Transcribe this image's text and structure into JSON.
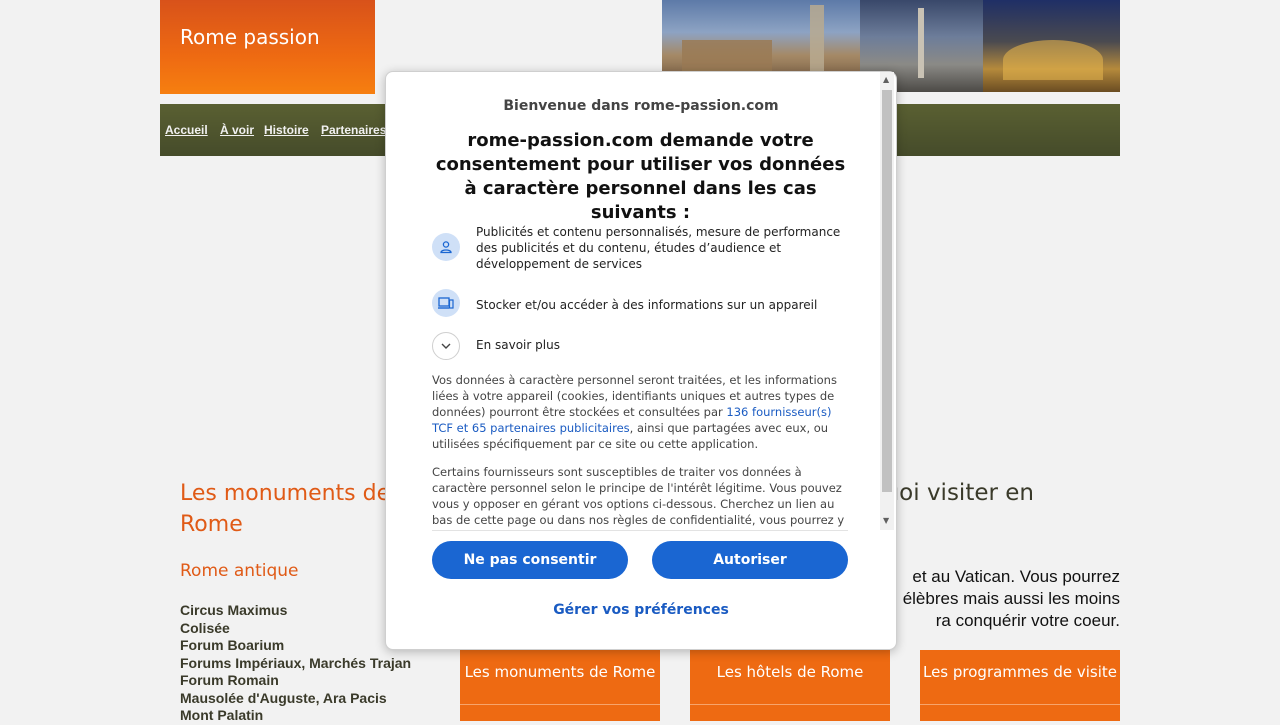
{
  "site": {
    "logo": "Rome passion",
    "nav": [
      "Accueil",
      "À voir",
      "Histoire",
      "Partenaires"
    ],
    "sidebar": {
      "title": "Les monuments de Rome",
      "subtitle": "Rome antique",
      "items": [
        "Circus Maximus",
        "Colisée",
        "Forum Boarium",
        "Forums Impériaux, Marchés Trajan",
        "Forum Romain",
        "Mausolée d'Auguste, Ara Pacis",
        "Mont Palatin"
      ]
    },
    "main": {
      "heading_fragment": "quoi visiter en",
      "text_lines": [
        "et au Vatican. Vous pourrez",
        "élèbres mais aussi les moins",
        "ra conquérir votre coeur."
      ],
      "tiles": [
        "Les monuments de Rome",
        "Les hôtels de Rome",
        "Les programmes de visite"
      ]
    }
  },
  "consent": {
    "welcome": "Bienvenue dans rome-passion.com",
    "title": "rome-passion.com demande votre consentement pour utiliser vos données à caractère personnel dans les cas suivants :",
    "purposes": [
      {
        "icon": "user-icon",
        "text": "Publicités et contenu personnalisés, mesure de performance des publicités et du contenu, études d’audience et développement de services"
      },
      {
        "icon": "devices-icon",
        "text": "Stocker et/ou accéder à des informations sur un appareil"
      }
    ],
    "learn_more": "En savoir plus",
    "para1_start": "Vos données à caractère personnel seront traitées, et les informations liées à votre appareil (cookies, identifiants uniques et autres types de données) pourront être stockées et consultées par ",
    "para1_link": "136 fournisseur(s) TCF et 65 partenaires publicitaires",
    "para1_end": ", ainsi que partagées avec eux, ou utilisées spécifiquement par ce site ou cette application.",
    "para2": "Certains fournisseurs sont susceptibles de traiter vos données à caractère personnel selon le principe de l'intérêt légitime. Vous pouvez vous y opposer en gérant vos options ci-dessous. Cherchez un lien au bas de cette page ou dans nos règles de confidentialité, vous pourrez y retirer",
    "btn_decline": "Ne pas consentir",
    "btn_accept": "Autoriser",
    "manage": "Gérer vos préférences",
    "accent_color": "#1a66d2"
  }
}
